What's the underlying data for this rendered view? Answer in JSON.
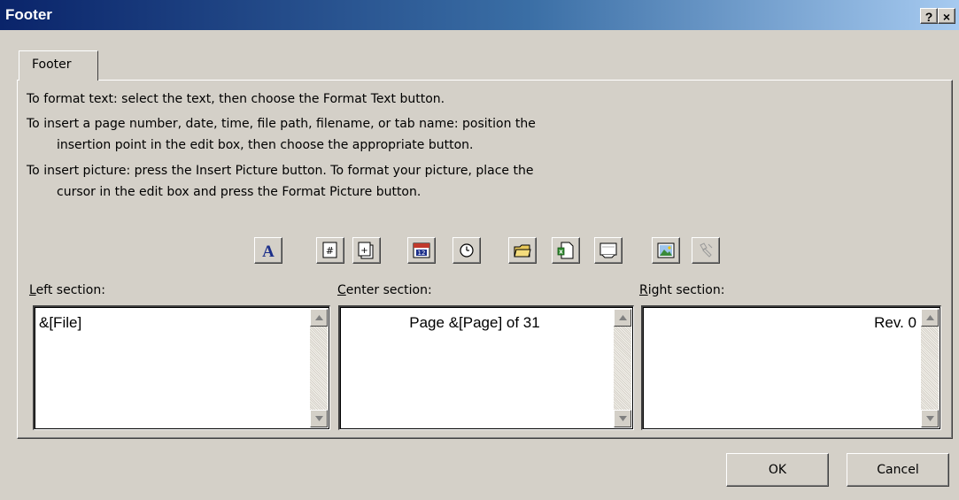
{
  "window": {
    "title": "Footer",
    "help_label": "?",
    "close_label": "×"
  },
  "tab": {
    "label": "Footer"
  },
  "instructions": [
    "To format text:  select the text, then choose the Format Text button.",
    "To insert a page number, date, time, file path, filename, or tab name:  position the",
    "insertion point in the edit box, then choose the appropriate button.",
    "To insert picture: press the Insert Picture button.  To format your picture, place the",
    "cursor in the edit box and press the Format Picture button."
  ],
  "toolbar": [
    {
      "name": "format-text-button",
      "icon": "format-text-icon",
      "enabled": true
    },
    {
      "name": "insert-page-number-button",
      "icon": "page-number-icon",
      "enabled": true
    },
    {
      "name": "insert-number-of-pages-button",
      "icon": "number-of-pages-icon",
      "enabled": true
    },
    {
      "name": "insert-date-button",
      "icon": "calendar-icon",
      "enabled": true
    },
    {
      "name": "insert-time-button",
      "icon": "clock-icon",
      "enabled": true
    },
    {
      "name": "insert-file-path-button",
      "icon": "folder-icon",
      "enabled": true
    },
    {
      "name": "insert-filename-button",
      "icon": "file-icon",
      "enabled": true
    },
    {
      "name": "insert-sheet-name-button",
      "icon": "sheet-tab-icon",
      "enabled": true
    },
    {
      "name": "insert-picture-button",
      "icon": "picture-icon",
      "enabled": true
    },
    {
      "name": "format-picture-button",
      "icon": "format-picture-icon",
      "enabled": false
    }
  ],
  "sections": {
    "left": {
      "label_accel": "L",
      "label_rest": "eft section:",
      "value": "&[File]"
    },
    "center": {
      "label_accel": "C",
      "label_rest": "enter section:",
      "value": "Page &[Page] of 31"
    },
    "right": {
      "label_accel": "R",
      "label_rest": "ight section:",
      "value": "Rev. 0"
    }
  },
  "buttons": {
    "ok": "OK",
    "cancel": "Cancel"
  },
  "colors": {
    "title_start": "#0a246a",
    "title_end": "#a6caf0",
    "face": "#d4d0c8"
  }
}
